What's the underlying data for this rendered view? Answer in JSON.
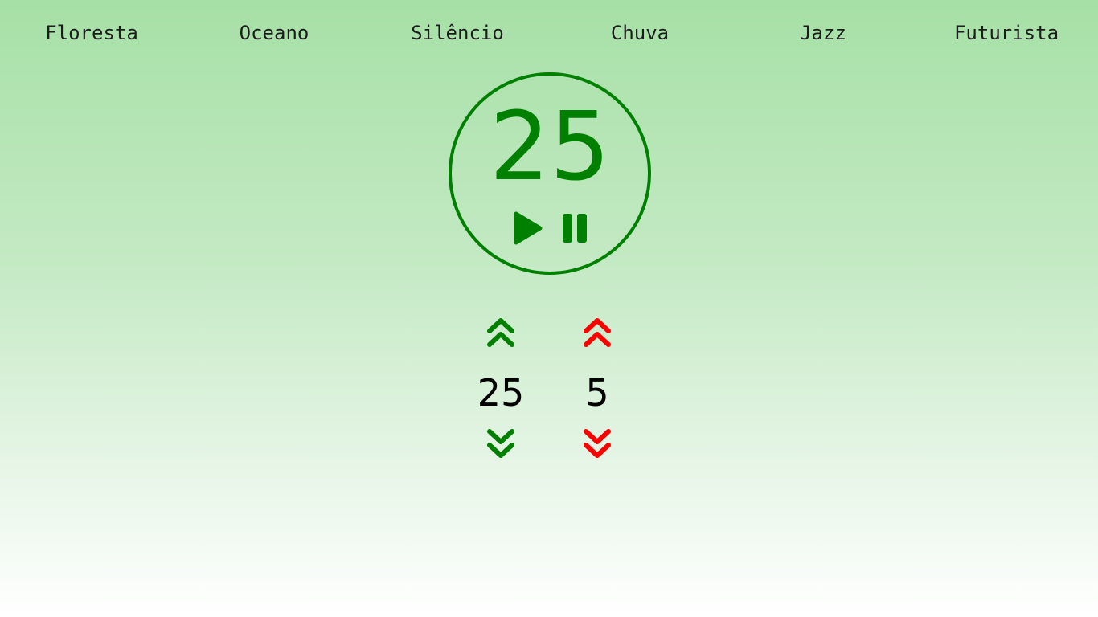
{
  "nav": {
    "items": [
      {
        "label": "Floresta"
      },
      {
        "label": "Oceano"
      },
      {
        "label": "Silêncio"
      },
      {
        "label": "Chuva"
      },
      {
        "label": "Jazz"
      },
      {
        "label": "Futurista"
      }
    ]
  },
  "timer": {
    "display": "25",
    "play_icon": "play-icon",
    "pause_icon": "pause-icon"
  },
  "work": {
    "value": "25",
    "increase_icon": "double-chevron-up-icon",
    "decrease_icon": "double-chevron-down-icon"
  },
  "break": {
    "value": "5",
    "increase_icon": "double-chevron-up-icon",
    "decrease_icon": "double-chevron-down-icon"
  },
  "colors": {
    "background_top": "#a6e0a6",
    "background_bottom": "#ffffff",
    "accent_green": "#008000",
    "accent_red": "#ff0000",
    "nav_text": "#1c1c1c"
  }
}
